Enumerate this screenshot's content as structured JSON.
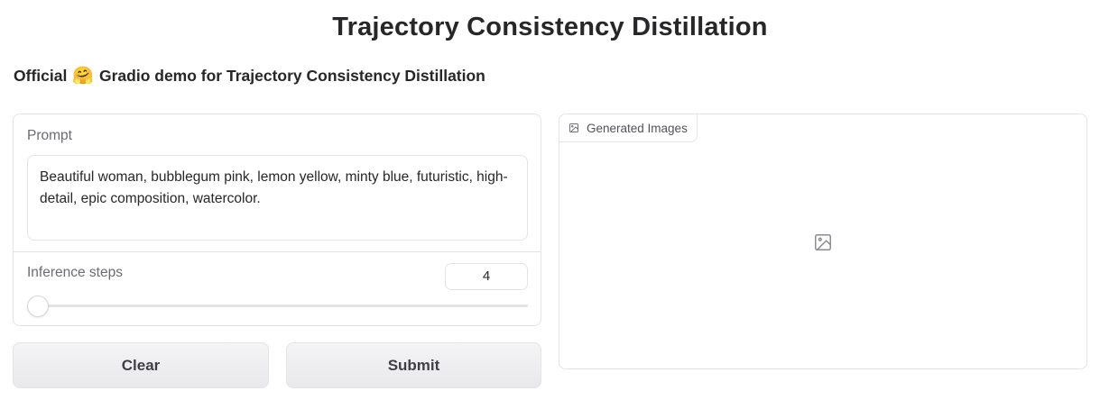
{
  "header": {
    "title": "Trajectory Consistency Distillation",
    "subtitle_prefix": "Official",
    "subtitle_emoji": "🤗",
    "subtitle_suffix": "Gradio demo for Trajectory Consistency Distillation"
  },
  "form": {
    "prompt_label": "Prompt",
    "prompt_value": "Beautiful woman, bubblegum pink, lemon yellow, minty blue, futuristic, high-detail, epic composition, watercolor.",
    "steps_label": "Inference steps",
    "steps_value": "4",
    "steps_slider_fraction": 0
  },
  "buttons": {
    "clear_label": "Clear",
    "submit_label": "Submit"
  },
  "output": {
    "gallery_label": "Generated Images",
    "gallery_icon": "image-icon",
    "empty_icon": "image-placeholder-icon"
  },
  "colors": {
    "accent": "#f97316",
    "border": "#e4e4e7",
    "button_bg": "#ececef"
  }
}
